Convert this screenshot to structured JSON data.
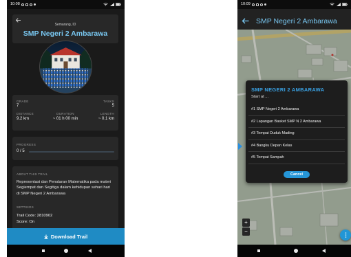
{
  "colors": {
    "accent": "#79c8f2",
    "button": "#1f8bc4",
    "cancel": "#2596d8",
    "dialog-title": "#3aa2e4",
    "card": "#282828",
    "phone": "#1a1a1a"
  },
  "left_phone": {
    "status_bar": {
      "time": "10:08",
      "icons": [
        "notification-icon",
        "message-icon",
        "settings-icon",
        "dot-icon",
        "wifi-icon",
        "signal-icon",
        "battery-icon"
      ]
    },
    "header": {
      "back_icon": "arrow-left-icon",
      "location": "Semarang, ID",
      "title": "SMP Negeri 2 Ambarawa"
    },
    "stats": {
      "grade": {
        "label": "GRADE",
        "value": "7"
      },
      "tasks": {
        "label": "TASKS",
        "value": "5"
      },
      "distance": {
        "label": "DISTANCE",
        "value": "9.2 km"
      },
      "duration": {
        "label": "DURATION",
        "value": "~ 01 h 00 min"
      },
      "length": {
        "label": "LENGTH",
        "value": "~ 0.1 km"
      }
    },
    "progress": {
      "label": "PROGRESS",
      "value": "0 / 5",
      "fraction": 0
    },
    "about": {
      "label": "ABOUT THIS TRAIL",
      "description": "Representasi dan Penalaran Matematika pada materi Segiempat dan Segitiga dalam kehidupan sehari hari di SMP Negeri 2 Ambarawa",
      "settings_label": "SETTINGS",
      "trail_code": "Trail Code: 2810902",
      "score": "Score: On"
    },
    "download_button": {
      "label": "Download Trail",
      "icon": "download-icon"
    },
    "nav_bar": {
      "icons": [
        "recent-apps-icon",
        "home-icon",
        "back-icon"
      ]
    }
  },
  "right_phone": {
    "status_bar": {
      "time": "10:09",
      "icons": [
        "notification-icon",
        "message-icon",
        "settings-icon",
        "dot-icon",
        "wifi-icon",
        "signal-icon",
        "battery-icon"
      ]
    },
    "header": {
      "back_icon": "arrow-left-icon",
      "title": "SMP Negeri 2 Ambarawa"
    },
    "dialog": {
      "title": "SMP NEGERI 2 AMBARAWA",
      "subtitle": "Start at ...",
      "items": [
        "#1 SMP Negeri 2 Ambarawa",
        "#2 Lapangan Basket SMP N 2 Ambarawa",
        "#3 Tempat Duduk Mading",
        "#4 Bangku Depan Kelas",
        "#5 Tempat Sampah"
      ],
      "cancel_label": "Cancel"
    },
    "map": {
      "zoom_in": "+",
      "zoom_out": "−",
      "fab_icon": "more-options-icon",
      "marker_icon": "location-arrow-icon"
    },
    "nav_bar": {
      "icons": [
        "recent-apps-icon",
        "home-icon",
        "back-icon"
      ]
    }
  }
}
